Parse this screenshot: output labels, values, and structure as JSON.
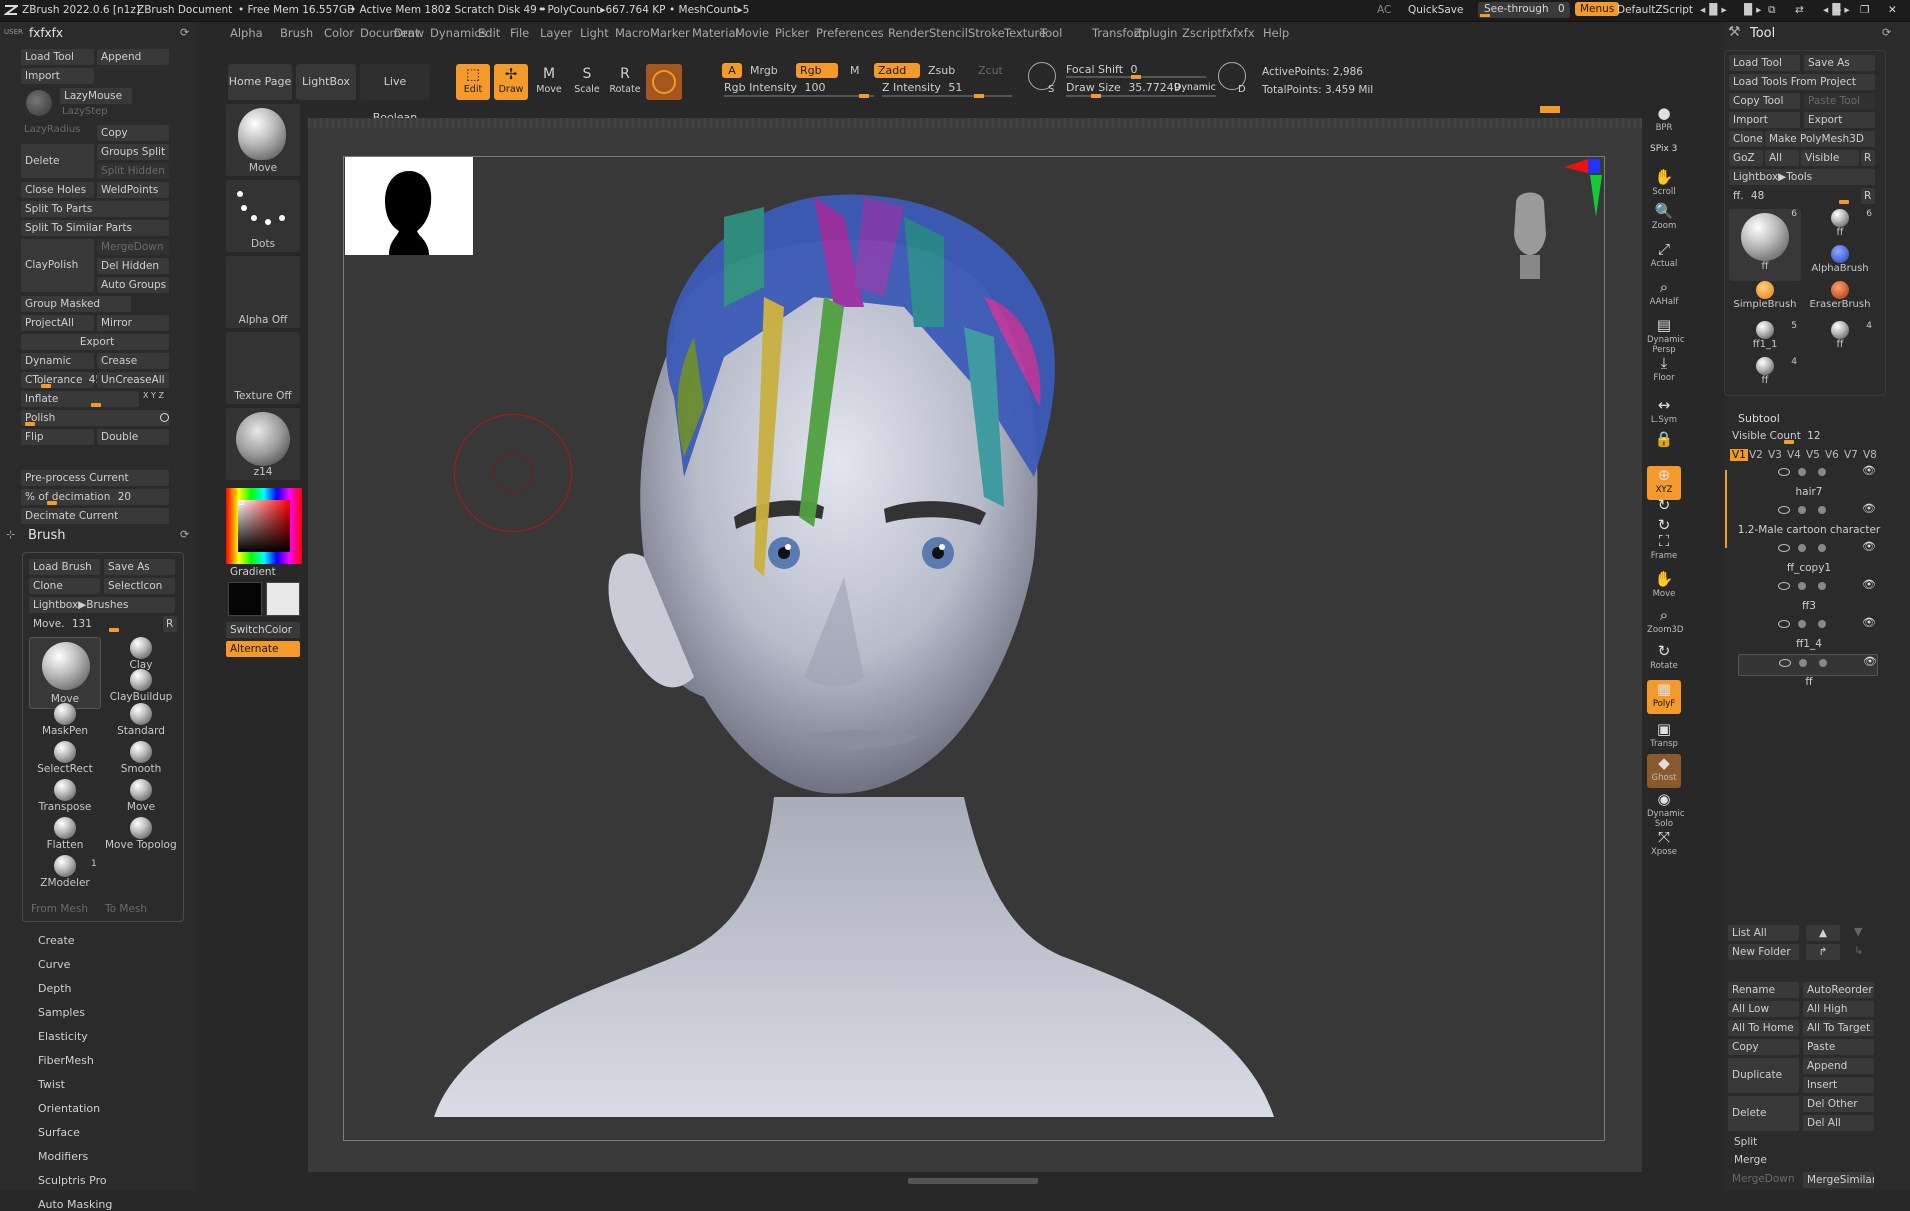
{
  "title_bar": {
    "app_version": "ZBrush 2022.0.6 [n1z]",
    "document": "ZBrush Document",
    "free_mem": "• Free Mem 16.557GB",
    "active_mem": "• Active Mem 1802",
    "scratch_disk": "• Scratch Disk 49 •",
    "polycount": "• PolyCount▸667.764 KP",
    "meshcount": "• MeshCount▸5",
    "ac": "AC",
    "quicksave": "QuickSave",
    "see_through": "See-through",
    "see_through_value": "0",
    "menus": "Menus",
    "script": "DefaultZScript"
  },
  "menubar": [
    "Alpha",
    "Brush",
    "Color",
    "Document",
    "Draw",
    "Dynamics",
    "Edit",
    "File",
    "Layer",
    "Light",
    "Macro",
    "Marker",
    "Material",
    "Movie",
    "Picker",
    "Preferences",
    "Render",
    "Stencil",
    "Stroke",
    "Texture",
    "Tool",
    "Transform",
    "Zplugin",
    "Zscript",
    "fxfxfx",
    "Help"
  ],
  "left_panel": {
    "user_label": "USER",
    "palette_title": "fxfxfx",
    "rows": {
      "load_tool": "Load Tool",
      "append": "Append",
      "import": "Import",
      "lazymouse": "LazyMouse",
      "lazyradius": "LazyRadius",
      "lazystep": "LazyStep",
      "copy": "Copy",
      "delete": "Delete",
      "groups_split": "Groups Split",
      "split_hidden": "Split Hidden",
      "close_holes": "Close Holes",
      "weldpoints": "WeldPoints",
      "split_to_parts": "Split To Parts",
      "split_similar": "Split To Similar Parts",
      "claypolish": "ClayPolish",
      "mergedown": "MergeDown",
      "del_hidden": "Del Hidden",
      "auto_groups": "Auto Groups",
      "group_masked": "Group Masked",
      "projectall": "ProjectAll",
      "mirror": "Mirror",
      "export": "Export",
      "dynamic": "Dynamic",
      "crease": "Crease",
      "ctolerance": "CTolerance",
      "ctolerance_value": "45",
      "uncreaseall": "UnCreaseAll",
      "inflate": "Inflate",
      "inflate_axes": "X Y Z",
      "polish": "Polish",
      "flip": "Flip",
      "double": "Double",
      "preprocess": "Pre-process Current",
      "decimation": "% of decimation",
      "decimation_value": "20",
      "decimate_current": "Decimate Current"
    },
    "brush_title": "Brush",
    "brush": {
      "load_brush": "Load Brush",
      "save_as": "Save As",
      "clone": "Clone",
      "selecticon": "SelectIcon",
      "lightbox_brushes": "Lightbox▶Brushes",
      "move_label": "Move.",
      "move_value": "131",
      "r": "R",
      "items": [
        "Move",
        "Clay",
        "ClayBuildup",
        "MaskPen",
        "Standard",
        "SelectRect",
        "Smooth",
        "Transpose",
        "Move",
        "Flatten",
        "Move Topologic",
        "ZModeler"
      ],
      "zmodeler_count": "1",
      "from_mesh": "From Mesh",
      "to_mesh": "To Mesh"
    },
    "sub_menus": [
      "Create",
      "Curve",
      "Depth",
      "Samples",
      "Elasticity",
      "FiberMesh",
      "Twist",
      "Orientation",
      "Surface",
      "Modifiers",
      "Sculptris Pro",
      "Auto Masking"
    ]
  },
  "shelf": {
    "home_page": "Home Page",
    "lightbox": "LightBox",
    "live_boolean": "Live Boolean",
    "edit": "Edit",
    "draw": "Draw",
    "move": "Move",
    "scale": "Scale",
    "rotate": "Rotate",
    "a": "A",
    "mrgb": "Mrgb",
    "rgb": "Rgb",
    "m": "M",
    "zadd": "Zadd",
    "zsub": "Zsub",
    "zcut": "Zcut",
    "rgb_intensity": "Rgb Intensity",
    "rgb_intensity_value": "100",
    "z_intensity": "Z Intensity",
    "z_intensity_value": "51",
    "focal_shift": "Focal Shift",
    "focal_shift_value": "0",
    "draw_size": "Draw Size",
    "draw_size_value": "35.77249",
    "dynamic": "Dynamic",
    "s": "S",
    "d": "D",
    "active_points": "ActivePoints: 2,986",
    "total_points": "TotalPoints: 3.459 Mil"
  },
  "left_shelf": {
    "move": "Move",
    "dots": "Dots",
    "alpha_off": "Alpha Off",
    "texture_off": "Texture Off",
    "material": "z14",
    "gradient": "Gradient",
    "switchcolor": "SwitchColor",
    "alternate": "Alternate"
  },
  "right_shelf": [
    "BPR",
    "SPix 3",
    "Scroll",
    "Zoom",
    "Actual",
    "AAHalf",
    "Dynamic Persp",
    "Floor",
    "L.Sym",
    "",
    "XYZ",
    "",
    "",
    "Frame",
    "Move",
    "Zoom3D",
    "Rotate",
    "PolyF",
    "Transp",
    "Ghost",
    "Dynamic Solo",
    "Xpose"
  ],
  "spix": "SPix 3",
  "tool_panel": {
    "title": "Tool",
    "load_tool": "Load Tool",
    "save_as": "Save As",
    "load_from_project": "Load Tools From Project",
    "copy_tool": "Copy Tool",
    "paste_tool": "Paste Tool",
    "import": "Import",
    "export": "Export",
    "clone": "Clone",
    "make_polymesh": "Make PolyMesh3D",
    "goz": "GoZ",
    "all": "All",
    "visible": "Visible",
    "r": "R",
    "lightbox_tools": "Lightbox▶Tools",
    "ff_label": "ff.",
    "ff_value": "48",
    "tools": [
      {
        "name": "ff",
        "count": "6"
      },
      {
        "name": "ff",
        "count": "6"
      },
      {
        "name": "AlphaBrush",
        "count": ""
      },
      {
        "name": "SimpleBrush",
        "count": ""
      },
      {
        "name": "EraserBrush",
        "count": ""
      },
      {
        "name": "ff1_1",
        "count": "5"
      },
      {
        "name": "ff",
        "count": "4"
      },
      {
        "name": "ff",
        "count": "4"
      }
    ],
    "subtool_title": "Subtool",
    "visible_count": "Visible Count",
    "visible_count_value": "12",
    "versions": [
      "V1",
      "V2",
      "V3",
      "V4",
      "V5",
      "V6",
      "V7",
      "V8"
    ],
    "subtools": [
      "hair7",
      "1.2-Male cartoon character",
      "ff_copy1",
      "ff3",
      "ff1_4",
      "ff"
    ],
    "list_all": "List All",
    "new_folder": "New Folder",
    "rename": "Rename",
    "autoreorder": "AutoReorder",
    "all_low": "All Low",
    "all_high": "All High",
    "all_to_home": "All To Home",
    "all_to_target": "All To Target",
    "copy": "Copy",
    "paste": "Paste",
    "duplicate": "Duplicate",
    "append": "Append",
    "insert": "Insert",
    "delete": "Delete",
    "del_other": "Del Other",
    "del_all": "Del All",
    "split": "Split",
    "merge": "Merge",
    "mergedown": "MergeDown",
    "mergesimilar": "MergeSimilar"
  },
  "colors": {
    "accent": "#f39a2a",
    "panel": "#2b2b2b",
    "button": "#393939",
    "canvas": "#383838"
  }
}
